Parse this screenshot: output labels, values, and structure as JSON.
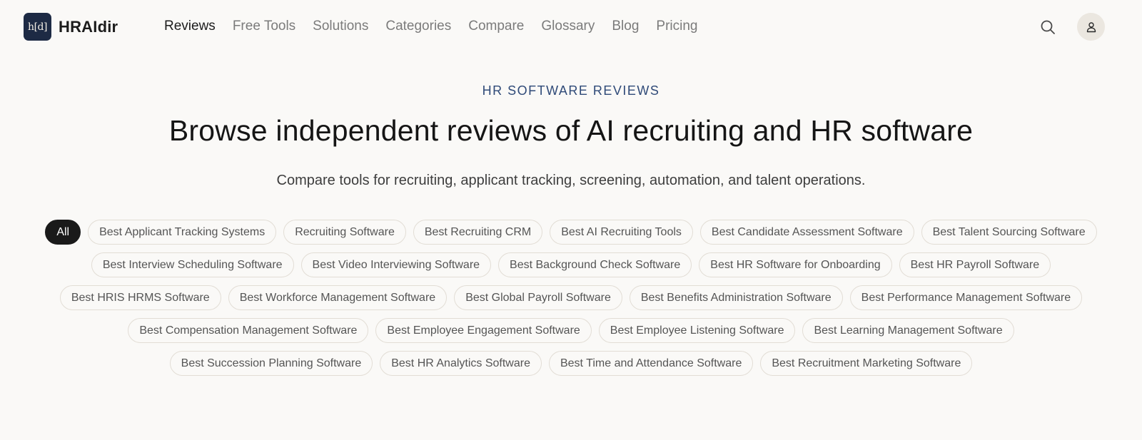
{
  "brand": {
    "mark": "h[d]",
    "name": "HRAIdir"
  },
  "nav": [
    {
      "label": "Reviews",
      "active": true
    },
    {
      "label": "Free Tools",
      "active": false
    },
    {
      "label": "Solutions",
      "active": false
    },
    {
      "label": "Categories",
      "active": false
    },
    {
      "label": "Compare",
      "active": false
    },
    {
      "label": "Glossary",
      "active": false
    },
    {
      "label": "Blog",
      "active": false
    },
    {
      "label": "Pricing",
      "active": false
    }
  ],
  "header_icons": {
    "search": "search-icon",
    "account": "user-icon"
  },
  "hero": {
    "eyebrow": "HR SOFTWARE REVIEWS",
    "headline": "Browse independent reviews of AI recruiting and HR software",
    "subhead": "Compare tools for recruiting, applicant tracking, screening, automation, and talent operations."
  },
  "filters": [
    {
      "label": "All",
      "active": true
    },
    {
      "label": "Best Applicant Tracking Systems"
    },
    {
      "label": "Recruiting Software"
    },
    {
      "label": "Best Recruiting CRM"
    },
    {
      "label": "Best AI Recruiting Tools"
    },
    {
      "label": "Best Candidate Assessment Software"
    },
    {
      "label": "Best Talent Sourcing Software"
    },
    {
      "label": "Best Interview Scheduling Software"
    },
    {
      "label": "Best Video Interviewing Software"
    },
    {
      "label": "Best Background Check Software"
    },
    {
      "label": "Best HR Software for Onboarding"
    },
    {
      "label": "Best HR Payroll Software"
    },
    {
      "label": "Best HRIS HRMS Software"
    },
    {
      "label": "Best Workforce Management Software"
    },
    {
      "label": "Best Global Payroll Software"
    },
    {
      "label": "Best Benefits Administration Software"
    },
    {
      "label": "Best Performance Management Software"
    },
    {
      "label": "Best Compensation Management Software"
    },
    {
      "label": "Best Employee Engagement Software"
    },
    {
      "label": "Best Employee Listening Software"
    },
    {
      "label": "Best Learning Management Software"
    },
    {
      "label": "Best Succession Planning Software"
    },
    {
      "label": "Best HR Analytics Software"
    },
    {
      "label": "Best Time and Attendance Software"
    },
    {
      "label": "Best Recruitment Marketing Software"
    }
  ],
  "colors": {
    "background": "#faf9f7",
    "logo_bg": "#1d2a44",
    "eyebrow": "#2f4a78",
    "active_chip": "#1a1a1a",
    "chip_border": "#e2ddd5"
  }
}
